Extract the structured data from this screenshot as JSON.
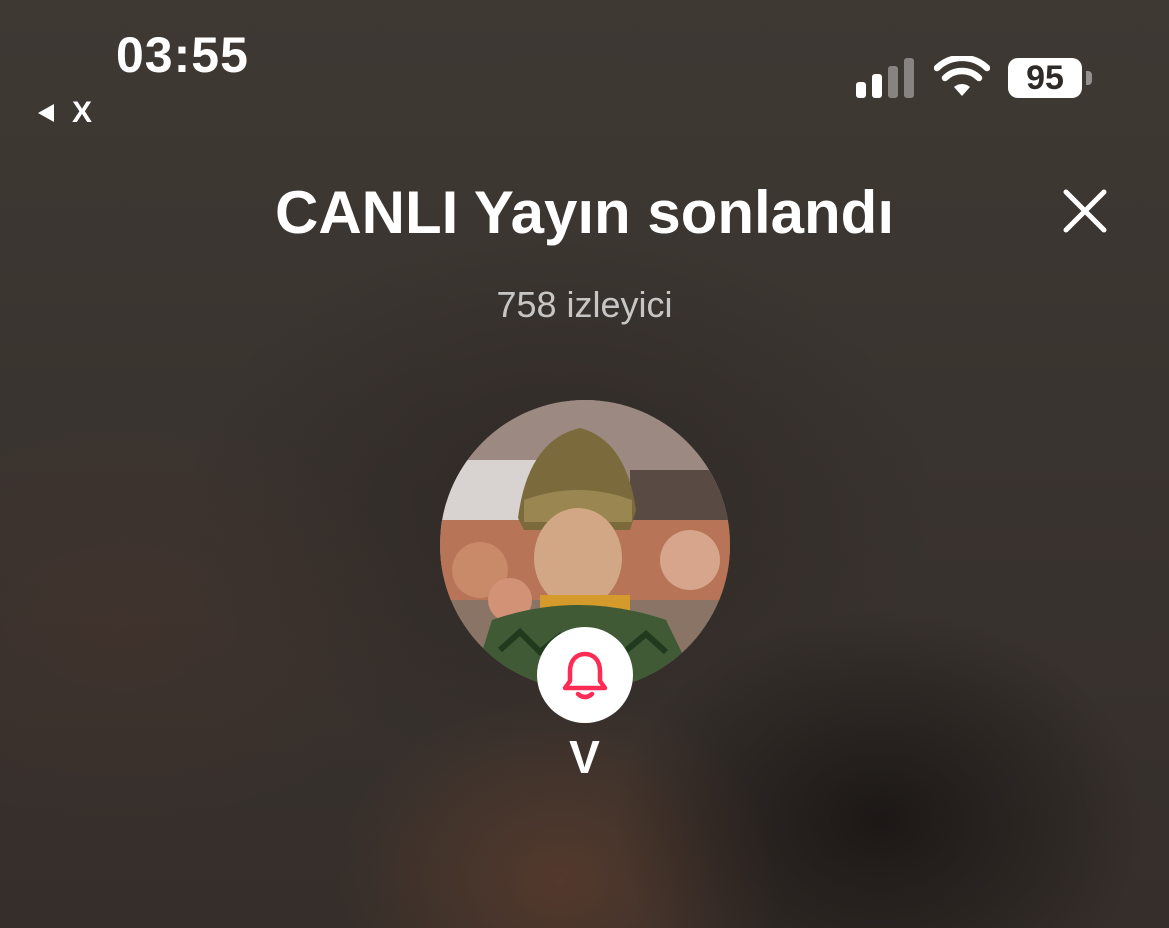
{
  "status_bar": {
    "time": "03:55",
    "back_app_label": "X",
    "battery_level": "95",
    "signal_bars_active": 2,
    "signal_bars_total": 4
  },
  "header": {
    "title": "CANLI Yayın sonlandı",
    "close_icon": "close-icon"
  },
  "stats": {
    "viewers_text": "758 izleyici"
  },
  "profile": {
    "username": "V",
    "notify_icon": "bell-icon",
    "accent_color": "#fe2c55"
  }
}
